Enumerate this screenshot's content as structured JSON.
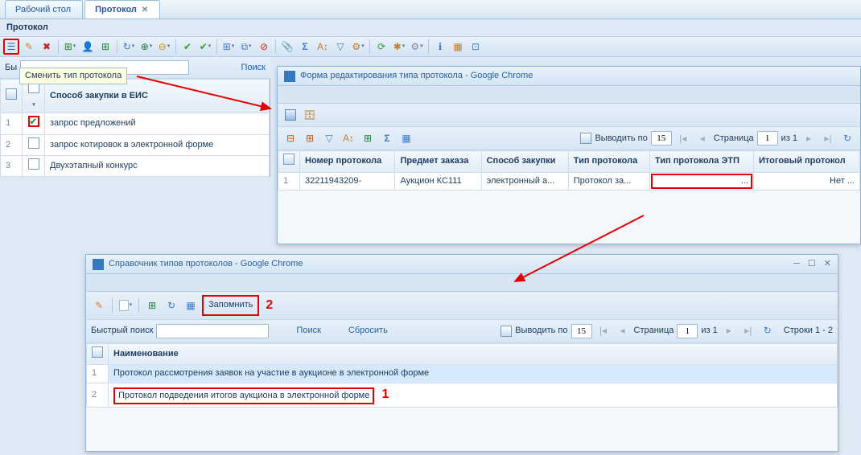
{
  "tabs": {
    "desktop": "Рабочий стол",
    "protocol": "Протокол"
  },
  "title": "Протокол",
  "tooltip_change_type": "Сменить тип протокола",
  "search": {
    "quick_label": "Бы",
    "search_btn": "Поиск"
  },
  "mainGrid": {
    "header": "Способ закупки в ЕИС",
    "rows": [
      {
        "n": "1",
        "text": "запрос предложений",
        "checked": true
      },
      {
        "n": "2",
        "text": "запрос котировок в электронной форме",
        "checked": false
      },
      {
        "n": "3",
        "text": "Двухэтапный конкурс",
        "checked": false
      }
    ]
  },
  "editWindow": {
    "title": "Форма редактирования типа протокола - Google Chrome",
    "pager": {
      "out_label": "Выводить по",
      "per_page": "15",
      "page_label": "Страница",
      "page": "1",
      "of_label": "из 1"
    },
    "cols": {
      "num": "Номер протокола",
      "subj": "Предмет заказа",
      "method": "Способ закупки",
      "ptype": "Тип протокола",
      "etp": "Тип протокола ЭТП",
      "final": "Итоговый протокол"
    },
    "row": {
      "n": "1",
      "num": "32211943209-",
      "subj": "Аукцион КС111",
      "method": "электронный а...",
      "ptype": "Протокол за...",
      "etp": "...",
      "final": "Нет ..."
    }
  },
  "dictWindow": {
    "title": "Справочник типов протоколов - Google Chrome",
    "remember_btn": "Запомнить",
    "quick_label": "Быстрый поиск",
    "search_btn": "Поиск",
    "reset_btn": "Сбросить",
    "pager": {
      "out_label": "Выводить по",
      "per_page": "15",
      "page_label": "Страница",
      "page": "1",
      "of_label": "из 1",
      "rows_label": "Строки 1 - 2"
    },
    "header": "Наименование",
    "rows": [
      {
        "n": "1",
        "text": "Протокол рассмотрения заявок на участие в аукционе в электронной форме"
      },
      {
        "n": "2",
        "text": "Протокол подведения итогов аукциона в электронной форме"
      }
    ]
  },
  "annot": {
    "one": "1",
    "two": "2"
  }
}
